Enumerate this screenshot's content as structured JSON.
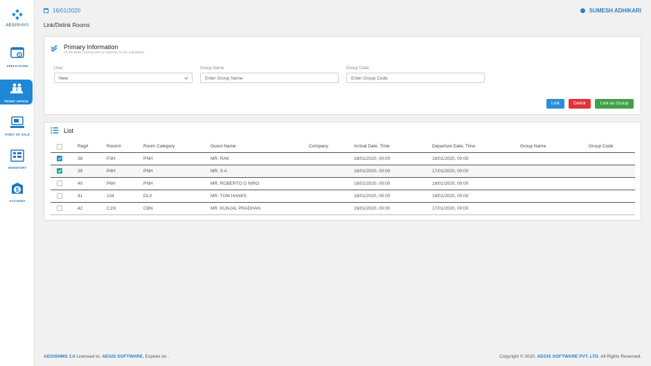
{
  "brand": {
    "logo_text_1": "AEGIS",
    "logo_text_2": "HMS"
  },
  "sidebar": {
    "items": [
      {
        "label": "APPLICATION",
        "icon": "application-icon"
      },
      {
        "label": "FRONT OFFICE",
        "icon": "front-office-icon",
        "active": true
      },
      {
        "label": "POINT OF SALE",
        "icon": "point-of-sale-icon"
      },
      {
        "label": "INVENTORY",
        "icon": "inventory-icon"
      },
      {
        "label": "ACCOUNT",
        "icon": "account-icon"
      }
    ]
  },
  "header": {
    "date": "16/01/2020",
    "user": "SUMESH ADHIKARI"
  },
  "page": {
    "title": "Link/Delink Rooms"
  },
  "primary": {
    "title": "Primary Information",
    "subtitle": "All the fields marked with an asterisk (*) are mandatory.",
    "user_label": "User",
    "user_value": "New",
    "group_name_label": "Group Name",
    "group_name_placeholder": "Enter Group Name",
    "group_code_label": "Group Code",
    "group_code_placeholder": "Enter Group Code",
    "btn_link": "Link",
    "btn_delink": "Delink",
    "btn_link_group": "Link as Group"
  },
  "list": {
    "title": "List",
    "columns": [
      "Reg#",
      "Room#",
      "Room Category",
      "Guest Name",
      "Company",
      "Arrival Date, Time",
      "Departure Date, Time",
      "Group Name",
      "Group Code"
    ],
    "rows": [
      {
        "checked": true,
        "reg": "38",
        "room": "P3H",
        "category": "PNH",
        "guest": "MR. RAK",
        "company": "",
        "arrival": "16/01/2020, 00:00",
        "departure": "16/01/2020, 00:00",
        "group_name": "",
        "group_code": ""
      },
      {
        "checked": true,
        "reg": "39",
        "room": "P4H",
        "category": "PNH",
        "guest": "MR. S A",
        "company": "",
        "arrival": "16/01/2020, 00:00",
        "departure": "17/01/2020, 00:00",
        "group_name": "",
        "group_code": ""
      },
      {
        "checked": false,
        "reg": "40",
        "room": "P6H",
        "category": "PNH",
        "guest": "MR. ROBERTO D NIRO",
        "company": "",
        "arrival": "16/01/2020, 00:00",
        "departure": "18/01/2020, 00:00",
        "group_name": "",
        "group_code": ""
      },
      {
        "checked": false,
        "reg": "41",
        "room": "104",
        "category": "DLX",
        "guest": "MR. TOM HANKS",
        "company": "",
        "arrival": "16/01/2020, 00:00",
        "departure": "18/01/2020, 00:00",
        "group_name": "",
        "group_code": ""
      },
      {
        "checked": false,
        "reg": "42",
        "room": "C1N",
        "category": "CBN",
        "guest": "MR. KUNJAL PRADHAN",
        "company": "",
        "arrival": "16/01/2020, 00:00",
        "departure": "17/01/2020, 00:00",
        "group_name": "",
        "group_code": ""
      }
    ]
  },
  "footer": {
    "product": "AEGISHMS 1.0",
    "licensed_text": " Licensed to: ",
    "licensee": "AEGIS SOFTWARE",
    "expires": ", Expires on .",
    "copyright": "Copyright © 2020, ",
    "company": "AEGIS SOFTWARE PVT. LTD.",
    "rights": " All Rights Reserved."
  },
  "colors": {
    "accent": "#2a8ad4",
    "delink": "#e03434",
    "group": "#43a047"
  }
}
